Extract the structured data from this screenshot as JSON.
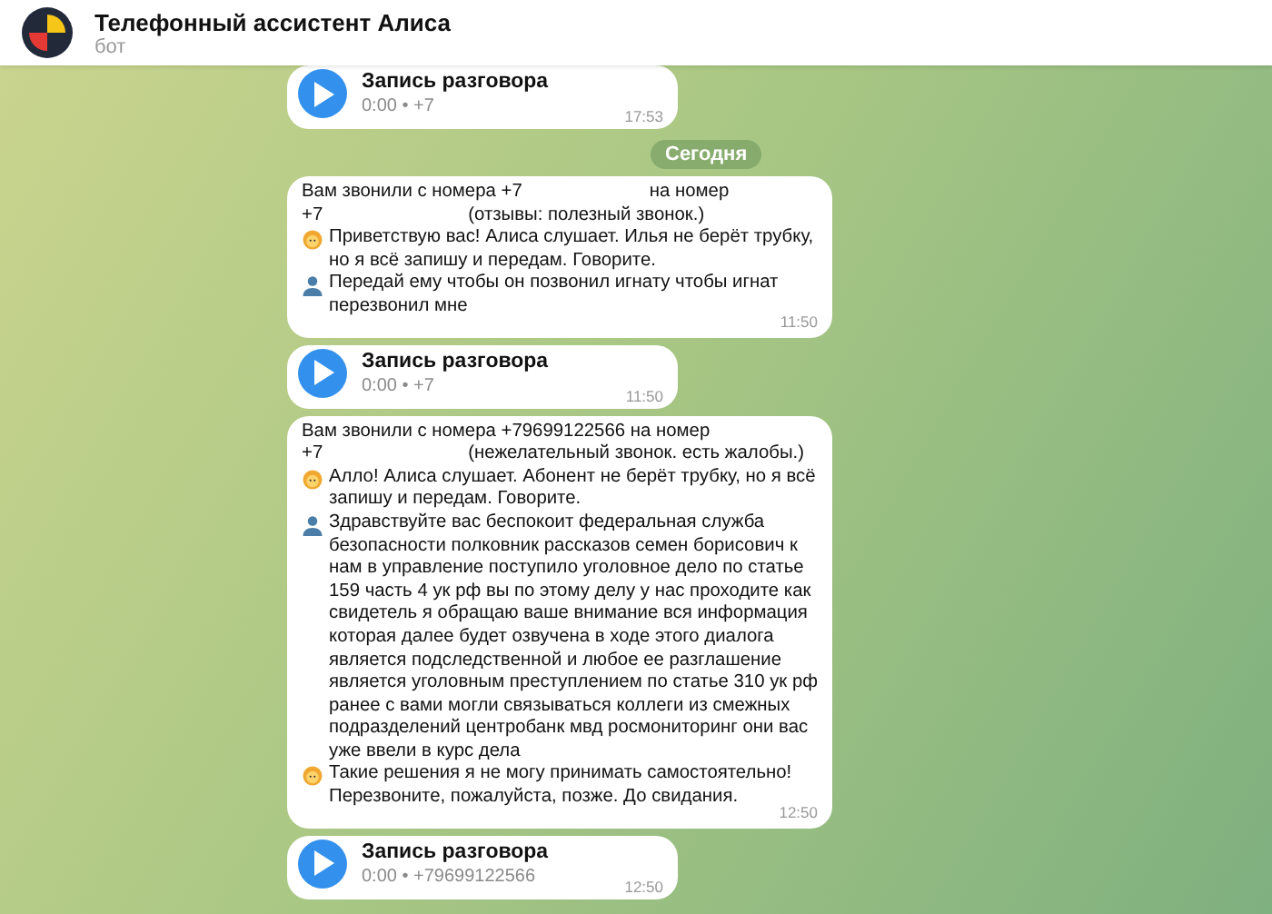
{
  "header": {
    "title": "Телефонный ассистент Алиса",
    "subtitle": "бот"
  },
  "messages": [
    {
      "kind": "audio",
      "title": "Запись разговора",
      "meta": "0:00 • +7",
      "time": "17:53"
    },
    {
      "kind": "date",
      "label": "Сегодня"
    },
    {
      "kind": "text",
      "time": "11:50",
      "lines": [
        {
          "kind": "info",
          "parts": [
            "Вам звонили с номера +7",
            "на номер"
          ]
        },
        {
          "kind": "info",
          "parts": [
            "+7",
            "(отзывы: полезный звонок.)"
          ]
        },
        {
          "kind": "assistant",
          "text": "Приветствую вас! Алиса слушает. Илья не берёт трубку, но я всё запишу и передам. Говорите."
        },
        {
          "kind": "caller",
          "text": "Передай ему чтобы он позвонил игнату чтобы игнат перезвонил мне"
        }
      ]
    },
    {
      "kind": "audio",
      "title": "Запись разговора",
      "meta": "0:00 • +7",
      "time": "11:50"
    },
    {
      "kind": "text",
      "time": "12:50",
      "lines": [
        {
          "kind": "info",
          "parts": [
            "Вам звонили с номера +79699122566 на номер"
          ]
        },
        {
          "kind": "info",
          "parts": [
            "+7",
            "(нежелательный звонок. есть жалобы.)"
          ]
        },
        {
          "kind": "assistant",
          "text": "Алло! Алиса слушает. Абонент не берёт трубку, но я всё запишу и передам. Говорите."
        },
        {
          "kind": "caller",
          "text": "Здравствуйте вас беспокоит федеральная служба безопасности полковник рассказов семен борисович к нам в управление поступило уголовное дело по статье 159 часть 4 ук рф вы по этому делу у нас проходите как свидетель я обращаю ваше внимание вся информация которая далее будет озвучена в ходе этого диалога является подследственной и любое ее разглашение является уголовным преступлением по статье 310 ук рф ранее с вами могли связываться коллеги из смежных подразделений центробанк мвд росмониторинг они вас уже ввели в курс дела"
        },
        {
          "kind": "assistant",
          "text": "Такие решения я не могу принимать самостоятельно! Перезвоните, пожалуйста, позже. До свидания."
        }
      ]
    },
    {
      "kind": "audio",
      "title": "Запись разговора",
      "meta": "0:00 • +79699122566",
      "time": "12:50"
    }
  ]
}
